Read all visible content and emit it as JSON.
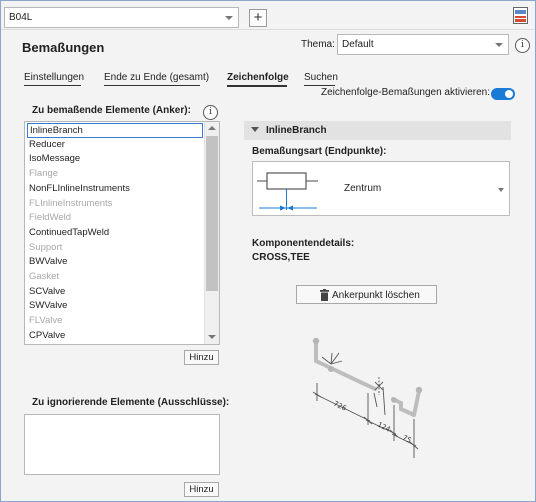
{
  "topbar": {
    "project_value": "B04L",
    "add_label": "+"
  },
  "header": {
    "title": "Bemaßungen",
    "theme_label": "Thema:",
    "theme_value": "Default",
    "info_glyph": "i"
  },
  "tabs": [
    {
      "label": "Einstellungen"
    },
    {
      "label": "Ende zu Ende (gesamt)"
    },
    {
      "label": "Zeichenfolge"
    },
    {
      "label": "Suchen"
    }
  ],
  "toggle": {
    "label": "Zeichenfolge-Bemaßungen aktivieren:",
    "state": "on"
  },
  "anchors": {
    "heading": "Zu bemaßende Elemente (Anker):",
    "items": [
      {
        "label": "InlineBranch",
        "state": "selected"
      },
      {
        "label": "Reducer",
        "state": "enabled"
      },
      {
        "label": "IsoMessage",
        "state": "enabled"
      },
      {
        "label": "Flange",
        "state": "disabled"
      },
      {
        "label": "NonFLInlineInstruments",
        "state": "enabled"
      },
      {
        "label": "FLInlineInstruments",
        "state": "disabled"
      },
      {
        "label": "FieldWeld",
        "state": "disabled"
      },
      {
        "label": "ContinuedTapWeld",
        "state": "enabled"
      },
      {
        "label": "Support",
        "state": "disabled"
      },
      {
        "label": "BWValve",
        "state": "enabled"
      },
      {
        "label": "Gasket",
        "state": "disabled"
      },
      {
        "label": "SCValve",
        "state": "enabled"
      },
      {
        "label": "SWValve",
        "state": "enabled"
      },
      {
        "label": "FLValve",
        "state": "disabled"
      },
      {
        "label": "CPValve",
        "state": "enabled"
      }
    ],
    "add_label": "Hinzu"
  },
  "exclusions": {
    "heading": "Zu ignorierende Elemente (Ausschlüsse):",
    "add_label": "Hinzu"
  },
  "detail": {
    "section_title": "InlineBranch",
    "type_label": "Bemaßungsart (Endpunkte):",
    "type_value": "Zentrum",
    "components_label": "Komponentendetails:",
    "components_value": "CROSS,TEE",
    "delete_label": "Ankerpunkt löschen"
  },
  "diagram": {
    "dimensions": [
      "726",
      "124",
      "75"
    ]
  },
  "colors": {
    "accent": "#1a7bd6",
    "selection_border": "#3a7ad1",
    "disabled_text": "#a8a8a8"
  }
}
